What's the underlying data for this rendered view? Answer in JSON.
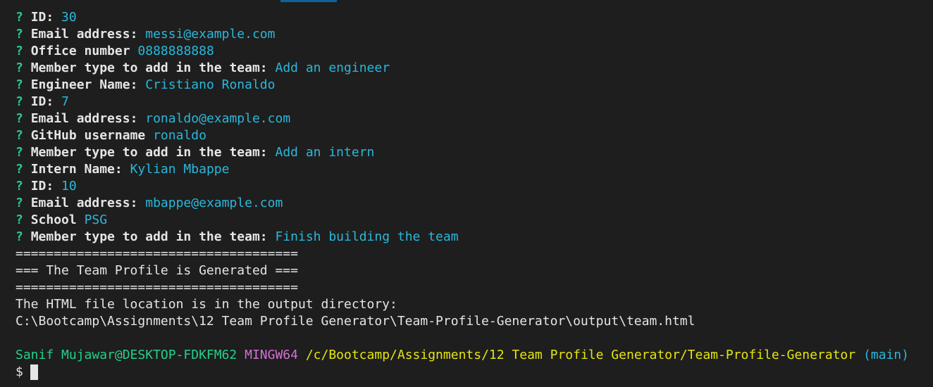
{
  "qa": [
    {
      "mark": "?",
      "label": "ID:",
      "answer": "30"
    },
    {
      "mark": "?",
      "label": "Email address:",
      "answer": "messi@example.com"
    },
    {
      "mark": "?",
      "label": "Office number",
      "answer": "0888888888"
    },
    {
      "mark": "?",
      "label": "Member type to add in the team:",
      "answer": "Add an engineer"
    },
    {
      "mark": "?",
      "label": "Engineer Name:",
      "answer": "Cristiano Ronaldo"
    },
    {
      "mark": "?",
      "label": "ID:",
      "answer": "7"
    },
    {
      "mark": "?",
      "label": "Email address:",
      "answer": "ronaldo@example.com"
    },
    {
      "mark": "?",
      "label": "GitHub username",
      "answer": "ronaldo"
    },
    {
      "mark": "?",
      "label": "Member type to add in the team:",
      "answer": "Add an intern"
    },
    {
      "mark": "?",
      "label": "Intern Name:",
      "answer": "Kylian Mbappe"
    },
    {
      "mark": "?",
      "label": "ID:",
      "answer": "10"
    },
    {
      "mark": "?",
      "label": "Email address:",
      "answer": "mbappe@example.com"
    },
    {
      "mark": "?",
      "label": "School",
      "answer": "PSG"
    },
    {
      "mark": "?",
      "label": "Member type to add in the team:",
      "answer": "Finish building the team"
    }
  ],
  "output": {
    "divider_top": "=====================================",
    "heading": "=== The Team Profile is Generated ===",
    "divider_bottom": "=====================================",
    "location_text": "The HTML file location is in the output directory:",
    "location_path": "C:\\Bootcamp\\Assignments\\12 Team Profile Generator\\Team-Profile-Generator\\output\\team.html"
  },
  "prompt": {
    "user_host": "Sanif Mujawar@DESKTOP-FDKFM62",
    "shell": "MINGW64",
    "cwd": "/c/Bootcamp/Assignments/12 Team Profile Generator/Team-Profile-Generator",
    "branch": "(main)",
    "symbol": "$"
  },
  "colors": {
    "background": "#1e1e1e",
    "question_mark": "#23d18b",
    "answer": "#29b8db",
    "user_host": "#23d18b",
    "shell": "#d670d6",
    "cwd": "#e5e510",
    "branch": "#29b8db"
  }
}
